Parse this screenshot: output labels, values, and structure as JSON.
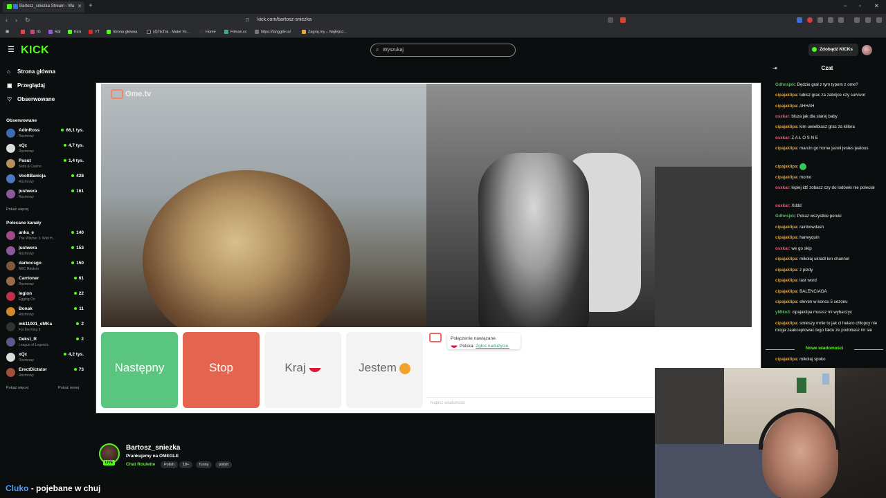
{
  "browser": {
    "tab_title": "Bartosz_sniezka Stream - Wa",
    "url": "kick.com/bartosz-sniezka",
    "bookmarks": [
      "IG",
      "Rat",
      "Kick",
      "YT",
      "Strona główna",
      "(4)TikTok - Make Yo...",
      "Home",
      "Filman.cc",
      "https://tangglle.io/",
      "Zagraj.my – Najlepsz..."
    ]
  },
  "kick": {
    "logo": "KICK",
    "search_placeholder": "Wyszukaj",
    "get_kicks": "Zdobądź KICKs",
    "nav": [
      "Strona główna",
      "Przeglądaj",
      "Obserwowane"
    ],
    "followed_header": "Obserwowane",
    "followed": [
      {
        "name": "AdinRoss",
        "category": "Rozmowy",
        "viewers": "66,1 tys.",
        "color": "#3f6bb3"
      },
      {
        "name": "xQc",
        "category": "Rozmowy",
        "viewers": "4,7 tys.",
        "color": "#dcdcdc"
      },
      {
        "name": "Pasut",
        "category": "Slots & Casino",
        "viewers": "1,4 tys.",
        "color": "#b98d60"
      },
      {
        "name": "VooltBanicja",
        "category": "Rozmowy",
        "viewers": "428",
        "color": "#4778c0"
      },
      {
        "name": "justwera",
        "category": "Rozmowy",
        "viewers": "161",
        "color": "#8a5a9a"
      }
    ],
    "show_more": "Pokaż więcej",
    "recommended_header": "Polecane kanały",
    "recommended": [
      {
        "name": "anka_e",
        "category": "The Witcher 3: Wild H...",
        "viewers": "140",
        "color": "#a04a8a"
      },
      {
        "name": "justwera",
        "category": "Rozmowy",
        "viewers": "153",
        "color": "#8a5a9a"
      },
      {
        "name": "darkocsgo",
        "category": "ARC Raiders",
        "viewers": "150",
        "color": "#7a5a3a"
      },
      {
        "name": "Carrioner",
        "category": "Rozmowy",
        "viewers": "61",
        "color": "#9a6a4a"
      },
      {
        "name": "legion",
        "category": "Egging On",
        "viewers": "22",
        "color": "#c0304a"
      },
      {
        "name": "Bonak",
        "category": "Rozmowy",
        "viewers": "11",
        "color": "#d08a2a"
      },
      {
        "name": "mk11001_eMKa",
        "category": "For the King II",
        "viewers": "2",
        "color": "#333333"
      },
      {
        "name": "Dekst_R",
        "category": "League of Legends",
        "viewers": "2",
        "color": "#5a5a8a"
      },
      {
        "name": "xQc",
        "category": "Rozmowy",
        "viewers": "4,2 tys.",
        "color": "#dcdcdc"
      },
      {
        "name": "ErectDictator",
        "category": "Rozmowy",
        "viewers": "73",
        "color": "#a0503a"
      }
    ],
    "show_more_2": "Pokaż więcej",
    "show_less": "Pokaż mniej"
  },
  "ome": {
    "logo": "Ome.tv",
    "buttons": {
      "next": "Następny",
      "stop": "Stop",
      "country": "Kraj",
      "iam": "Jestem"
    },
    "connected": "Połączenie nawiązane.",
    "country_line": "Polska.",
    "report_link": "Zgłoś nadużycie.",
    "input_placeholder": "Napisz wiadomość"
  },
  "stream": {
    "name": "Bartosz_sniezka",
    "title": "Prankujemy na OMEGLE",
    "category": "Chat Roulette",
    "tags": [
      "Polish",
      "18+",
      "funny",
      "polish"
    ],
    "live": "LIVE"
  },
  "chat": {
    "title": "Czat",
    "new_messages": "Nowe wiadomości",
    "messages": [
      {
        "user": "Gdhnsjxk",
        "color": "#4ec05a",
        "text": "Będzie grał z tym typem z ome?"
      },
      {
        "user": "cipajaklipa",
        "color": "#e2a33b",
        "text": "lubisz grac za zabójce czy survivor"
      },
      {
        "user": "cipajaklipa",
        "color": "#e2a33b",
        "text": "AHHAH"
      },
      {
        "user": "osxkar",
        "color": "#e0657a",
        "text": "bluza jak dla starej baby"
      },
      {
        "user": "cipajaklipa",
        "color": "#e2a33b",
        "text": "kim uwielbiasz grac za killera"
      },
      {
        "user": "osxkar",
        "color": "#e0657a",
        "text": "Z A Ł O S N E"
      },
      {
        "user": "cipajaklipa",
        "color": "#e2a33b",
        "text": "marcin go home jezeli jestes jealous"
      },
      {
        "user": "cipajaklipa",
        "color": "#e2a33b",
        "text": ""
      },
      {
        "user": "cipajaklipa",
        "color": "#e2a33b",
        "text": "momo"
      },
      {
        "user": "osxkar",
        "color": "#e0657a",
        "text": "lepiej idź zobacz czy do lodówki nie poleciał"
      },
      {
        "user": "osxkar",
        "color": "#e0657a",
        "text": "Xddd"
      },
      {
        "user": "Gdhnsjxk",
        "color": "#4ec05a",
        "text": "Pokaż wszystkie peruki"
      },
      {
        "user": "cipajaklipa",
        "color": "#e2a33b",
        "text": "rainbowdash"
      },
      {
        "user": "cipajaklipa",
        "color": "#e2a33b",
        "text": "harleyquin"
      },
      {
        "user": "osxkar",
        "color": "#e0657a",
        "text": "we go skip"
      },
      {
        "user": "cipajaklipa",
        "color": "#e2a33b",
        "text": "mikolaj ukradł ten channel"
      },
      {
        "user": "cipajaklipa",
        "color": "#e2a33b",
        "text": "z pizdy"
      },
      {
        "user": "cipajaklipa",
        "color": "#e2a33b",
        "text": "last word"
      },
      {
        "user": "cipajaklipa",
        "color": "#e2a33b",
        "text": "BALENCIAGA"
      },
      {
        "user": "cipajaklipa",
        "color": "#e2a33b",
        "text": "eleven w koncu 5 sezonu"
      },
      {
        "user": "yMiko3",
        "color": "#4ec05a",
        "text": "cipajaklipa musisz mi wybaczyc"
      },
      {
        "user": "cipajaklipa",
        "color": "#e2a33b",
        "text": "smieszy mnie to jak ci hetero chlopcy nie moga zaakceptowac tego faktu ze podobasz im sie"
      },
      {
        "user": "cipajaklipa",
        "color": "#e2a33b",
        "text": "mikolaj spoko"
      }
    ]
  },
  "overlay": {
    "bottom_text_a": "Cluko",
    "bottom_text_b": "- pojebane w chuj"
  }
}
